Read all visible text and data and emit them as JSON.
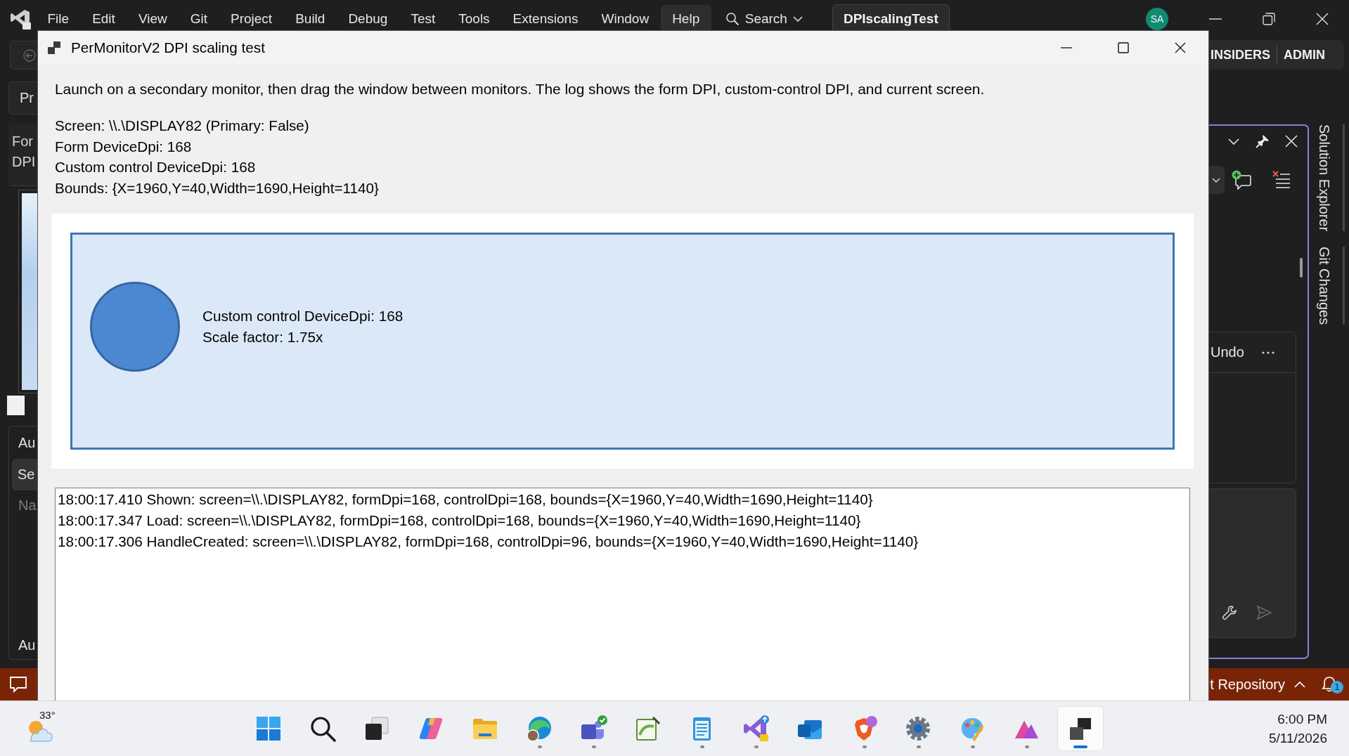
{
  "ide": {
    "menu": [
      {
        "label": "File",
        "selected": false
      },
      {
        "label": "Edit",
        "selected": false
      },
      {
        "label": "View",
        "selected": false
      },
      {
        "label": "Git",
        "selected": false
      },
      {
        "label": "Project",
        "selected": false
      },
      {
        "label": "Build",
        "selected": false
      },
      {
        "label": "Debug",
        "selected": false
      },
      {
        "label": "Test",
        "selected": false
      },
      {
        "label": "Tools",
        "selected": false
      },
      {
        "label": "Extensions",
        "selected": false
      },
      {
        "label": "Window",
        "selected": false
      },
      {
        "label": "Help",
        "selected": true
      }
    ],
    "search": {
      "label": "Search"
    },
    "solution_tab": "DPIscalingTest",
    "account": {
      "initials": "SA"
    },
    "editions": [
      "INSIDERS",
      "ADMIN"
    ],
    "left_pane": {
      "button": "Pr",
      "properties": [
        "For",
        "DPI"
      ],
      "section_title": "Au",
      "section_tab": "Se",
      "column_header": "Na",
      "footer": "Au"
    },
    "chat_panel": {
      "action": "Undo"
    },
    "side_tabs": [
      "Solution Explorer",
      "Git Changes"
    ],
    "status_bar": {
      "repository": "t Repository",
      "notifications": "1"
    }
  },
  "dialog": {
    "title": "PerMonitorV2 DPI scaling test",
    "instructions": "Launch on a secondary monitor, then drag the window between monitors. The log shows the form DPI, custom-control DPI, and current screen.",
    "info": [
      "Screen: \\\\.\\DISPLAY82 (Primary: False)",
      "Form DeviceDpi: 168",
      "Custom control DeviceDpi: 168",
      "Bounds: {X=1960,Y=40,Width=1690,Height=1140}"
    ],
    "custom_control": [
      "Custom control DeviceDpi: 168",
      "Scale factor: 1.75x"
    ],
    "log": [
      "18:00:17.410 Shown: screen=\\\\.\\DISPLAY82, formDpi=168, controlDpi=168, bounds={X=1960,Y=40,Width=1690,Height=1140}",
      "18:00:17.347 Load: screen=\\\\.\\DISPLAY82, formDpi=168, controlDpi=168, bounds={X=1960,Y=40,Width=1690,Height=1140}",
      "18:00:17.306 HandleCreated: screen=\\\\.\\DISPLAY82, formDpi=168, controlDpi=96, bounds={X=1960,Y=40,Width=1690,Height=1140}"
    ]
  },
  "taskbar": {
    "weather": {
      "temperature": "33°"
    },
    "apps": [
      {
        "kind": "start",
        "running": false,
        "selected": false
      },
      {
        "kind": "search",
        "running": false,
        "selected": false
      },
      {
        "kind": "task_view",
        "running": false,
        "selected": false
      },
      {
        "kind": "assistant",
        "running": false,
        "selected": false
      },
      {
        "kind": "files",
        "running": false,
        "selected": false
      },
      {
        "kind": "browser",
        "running": true,
        "selected": false
      },
      {
        "kind": "chat",
        "running": true,
        "selected": false
      },
      {
        "kind": "editor",
        "running": false,
        "selected": false
      },
      {
        "kind": "notepad",
        "running": true,
        "selected": false
      },
      {
        "kind": "ide",
        "running": true,
        "selected": false
      },
      {
        "kind": "mail",
        "running": false,
        "selected": false
      },
      {
        "kind": "shield",
        "running": true,
        "selected": false
      },
      {
        "kind": "settings",
        "running": true,
        "selected": false
      },
      {
        "kind": "paint",
        "running": true,
        "selected": false
      },
      {
        "kind": "design",
        "running": true,
        "selected": false
      },
      {
        "kind": "window",
        "running": true,
        "selected": true
      }
    ],
    "clock": {
      "time": "6:00 PM",
      "date": "5/11/2026"
    }
  }
}
